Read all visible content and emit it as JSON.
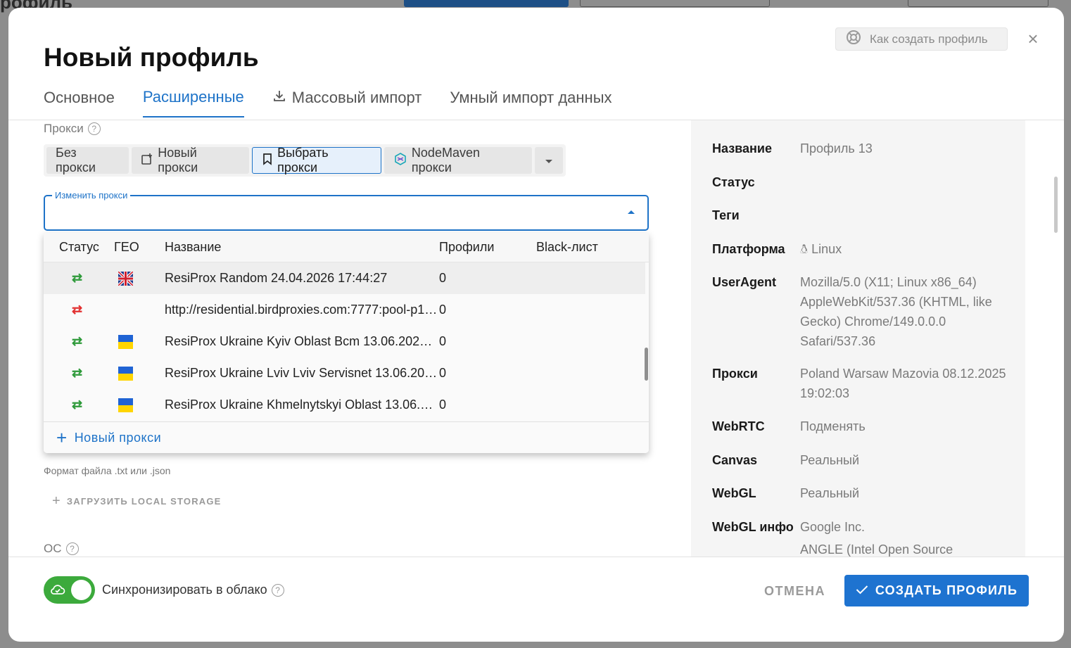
{
  "background": {
    "title": "рофиль"
  },
  "modal": {
    "help_button": "Как создать профиль",
    "title": "Новый профиль",
    "tabs": [
      {
        "label": "Основное"
      },
      {
        "label": "Расширенные"
      },
      {
        "label": "Массовый импорт"
      },
      {
        "label": "Умный импорт данных"
      }
    ],
    "active_tab": "Расширенные"
  },
  "proxy": {
    "section_label": "Прокси",
    "segments": [
      {
        "label": "Без прокси"
      },
      {
        "label": "Новый прокси"
      },
      {
        "label": "Выбрать прокси"
      },
      {
        "label": "NodeMaven прокси"
      }
    ],
    "selected_segment": "Выбрать прокси",
    "change_field_label": "Изменить прокси",
    "table": {
      "headers": [
        "Статус",
        "ГЕО",
        "Название",
        "Профили",
        "Black-лист"
      ],
      "rows": [
        {
          "status": "ok",
          "flag": "uk",
          "name": "ResiProx Random 24.04.2026 17:44:27",
          "profiles": "0"
        },
        {
          "status": "bad",
          "flag": "",
          "name": "http://residential.birdproxies.com:7777:pool-p1-...",
          "profiles": "0"
        },
        {
          "status": "ok",
          "flag": "ua",
          "name": "ResiProx Ukraine Kyiv Oblast Bcm 13.06.2026 09...",
          "profiles": "0"
        },
        {
          "status": "ok",
          "flag": "ua",
          "name": "ResiProx Ukraine Lviv Lviv Servisnet 13.06.2026 ...",
          "profiles": "0"
        },
        {
          "status": "ok",
          "flag": "ua",
          "name": "ResiProx Ukraine Khmelnytskyi Oblast 13.06.202...",
          "profiles": "0"
        }
      ]
    },
    "new_proxy_link": "Новый прокси"
  },
  "storage": {
    "format_note": "Формат файла .txt или .json",
    "upload_local_storage": "ЗАГРУЗИТЬ LOCAL STORAGE"
  },
  "os": {
    "label": "ОС"
  },
  "summary": {
    "name_key": "Название",
    "name_val": "Профиль 13",
    "status_key": "Статус",
    "tags_key": "Теги",
    "platform_key": "Платформа",
    "platform_val": "Linux",
    "ua_key": "UserAgent",
    "ua_val": "Mozilla/5.0 (X11; Linux x86_64) AppleWebKit/537.36 (KHTML, like Gecko) Chrome/149.0.0.0 Safari/537.36",
    "proxy_key": "Прокси",
    "proxy_val": "Poland Warsaw Mazovia 08.12.2025 19:02:03",
    "webrtc_key": "WebRTC",
    "webrtc_val": "Подменять",
    "canvas_key": "Canvas",
    "canvas_val": "Реальный",
    "webgl_key": "WebGL",
    "webgl_val": "Реальный",
    "webglinfo_key": "WebGL инфо",
    "webglinfo_val": "Google Inc.",
    "webglinfo_val2": "ANGLE (Intel Open Source"
  },
  "footer": {
    "sync_label": "Синхронизировать в облако",
    "sync_enabled": true,
    "cancel": "ОТМЕНА",
    "create": "СОЗДАТЬ ПРОФИЛЬ"
  },
  "colors": {
    "accent": "#1e73c8",
    "status_ok": "#2e9a3a",
    "status_bad": "#e23030",
    "toggle_on": "#3caa3c"
  }
}
